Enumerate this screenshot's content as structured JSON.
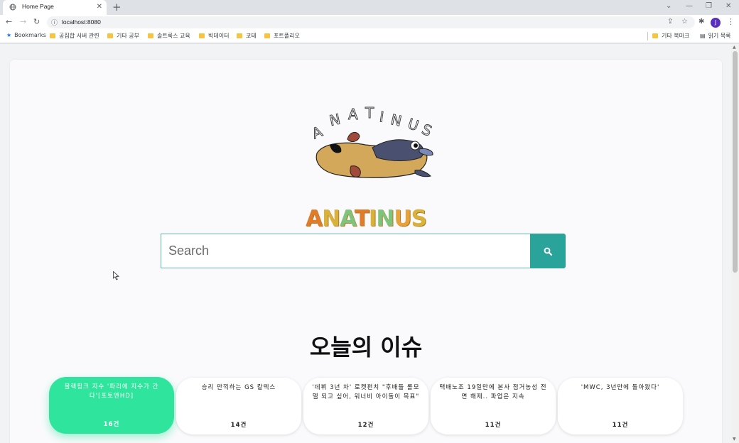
{
  "browser": {
    "tab_title": "Home Page",
    "tab_close": "✕",
    "new_tab": "+",
    "url": "localhost:8080",
    "profile_initial": "J"
  },
  "bookmarks": {
    "items": [
      "Bookmarks",
      "공집합 서버 관련",
      "기타 공부",
      "솔트룩스 교육",
      "빅데이터",
      "코테",
      "포트폴리오"
    ],
    "other_bookmarks": "기타 북마크",
    "reading_list": "읽기 목록"
  },
  "page": {
    "brand": "ANATINUS",
    "brand_colors": [
      "#e07b2a",
      "#d9b23c",
      "#7fc47a",
      "#e07b2a",
      "#d9b23c",
      "#7fc47a",
      "#e8a23a",
      "#d9b23c"
    ],
    "search_placeholder": "Search",
    "heading": "오늘의 이슈",
    "accent": "#2fe49c",
    "button_color": "#2aa39a"
  },
  "issues": [
    {
      "text": "블랙핑크 지수 '파리에 지수가 간다'[포토엔HD]",
      "count": "16건",
      "active": true
    },
    {
      "text": "승리 만끽하는 GS 칼텍스",
      "count": "14건",
      "active": false
    },
    {
      "text": "'데뷔 3년 차' 로켓펀치 \"후배들 롤모델 되고 싶어, 워너비 아이돌이 목표\"",
      "count": "12건",
      "active": false
    },
    {
      "text": "택배노조 19일만에 본사 점거농성 전면 해제.. 파업은 지속",
      "count": "11건",
      "active": false
    },
    {
      "text": "'MWC, 3년만에 돌아왔다'",
      "count": "11건",
      "active": false
    }
  ]
}
